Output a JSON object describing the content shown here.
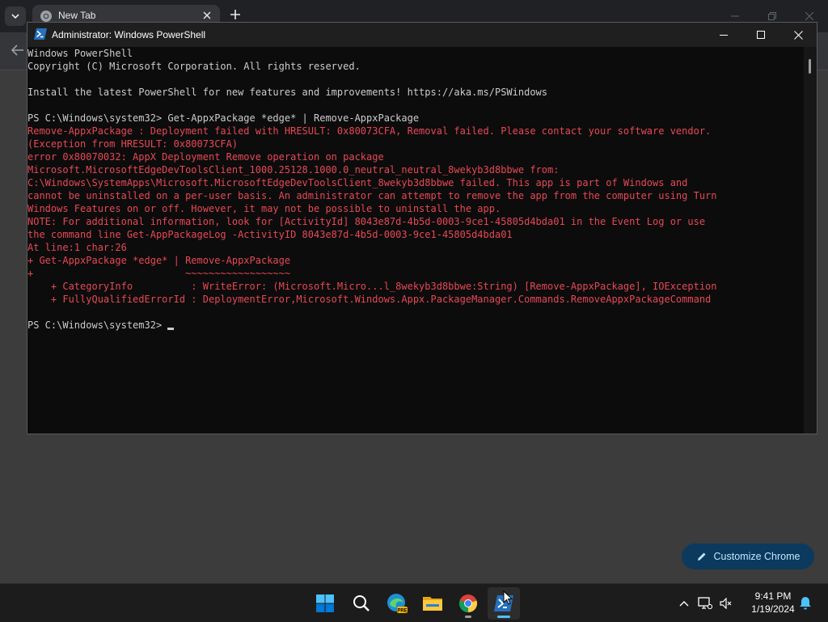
{
  "chrome": {
    "tab_title": "New Tab",
    "customize_label": "Customize Chrome"
  },
  "powershell": {
    "window_title": "Administrator: Windows PowerShell",
    "lines": [
      {
        "text": "Windows PowerShell",
        "style": "normal"
      },
      {
        "text": "Copyright (C) Microsoft Corporation. All rights reserved.",
        "style": "normal"
      },
      {
        "text": "",
        "style": "normal"
      },
      {
        "text": "Install the latest PowerShell for new features and improvements! https://aka.ms/PSWindows",
        "style": "normal"
      },
      {
        "text": "",
        "style": "normal"
      },
      {
        "text": "PS C:\\Windows\\system32> Get-AppxPackage *edge* | Remove-AppxPackage",
        "style": "normal"
      },
      {
        "text": "Remove-AppxPackage : Deployment failed with HRESULT: 0x80073CFA, Removal failed. Please contact your software vendor.",
        "style": "error"
      },
      {
        "text": "(Exception from HRESULT: 0x80073CFA)",
        "style": "error"
      },
      {
        "text": "error 0x80070032: AppX Deployment Remove operation on package",
        "style": "error"
      },
      {
        "text": "Microsoft.MicrosoftEdgeDevToolsClient_1000.25128.1000.0_neutral_neutral_8wekyb3d8bbwe from:",
        "style": "error"
      },
      {
        "text": "C:\\Windows\\SystemApps\\Microsoft.MicrosoftEdgeDevToolsClient_8wekyb3d8bbwe failed. This app is part of Windows and",
        "style": "error"
      },
      {
        "text": "cannot be uninstalled on a per-user basis. An administrator can attempt to remove the app from the computer using Turn",
        "style": "error"
      },
      {
        "text": "Windows Features on or off. However, it may not be possible to uninstall the app.",
        "style": "error"
      },
      {
        "text": "NOTE: For additional information, look for [ActivityId] 8043e87d-4b5d-0003-9ce1-45805d4bda01 in the Event Log or use",
        "style": "error"
      },
      {
        "text": "the command line Get-AppPackageLog -ActivityID 8043e87d-4b5d-0003-9ce1-45805d4bda01",
        "style": "error"
      },
      {
        "text": "At line:1 char:26",
        "style": "error"
      },
      {
        "text": "+ Get-AppxPackage *edge* | Remove-AppxPackage",
        "style": "error"
      },
      {
        "text": "+                          ~~~~~~~~~~~~~~~~~~",
        "style": "error"
      },
      {
        "text": "    + CategoryInfo          : WriteError: (Microsoft.Micro...l_8wekyb3d8bbwe:String) [Remove-AppxPackage], IOException",
        "style": "error"
      },
      {
        "text": "    + FullyQualifiedErrorId : DeploymentError,Microsoft.Windows.Appx.PackageManager.Commands.RemoveAppxPackageCommand",
        "style": "error"
      },
      {
        "text": "",
        "style": "normal"
      }
    ],
    "prompt": "PS C:\\Windows\\system32> "
  },
  "taskbar": {
    "apps": [
      "start-icon",
      "search-icon",
      "edge-pre-icon",
      "file-explorer-icon",
      "chrome-icon",
      "powershell-icon"
    ],
    "time": "9:41 PM",
    "date": "1/19/2024"
  },
  "colors": {
    "console_bg": "#0c0c0c",
    "console_fg": "#cccccc",
    "error_fg": "#e74856",
    "accent": "#0078d4"
  }
}
